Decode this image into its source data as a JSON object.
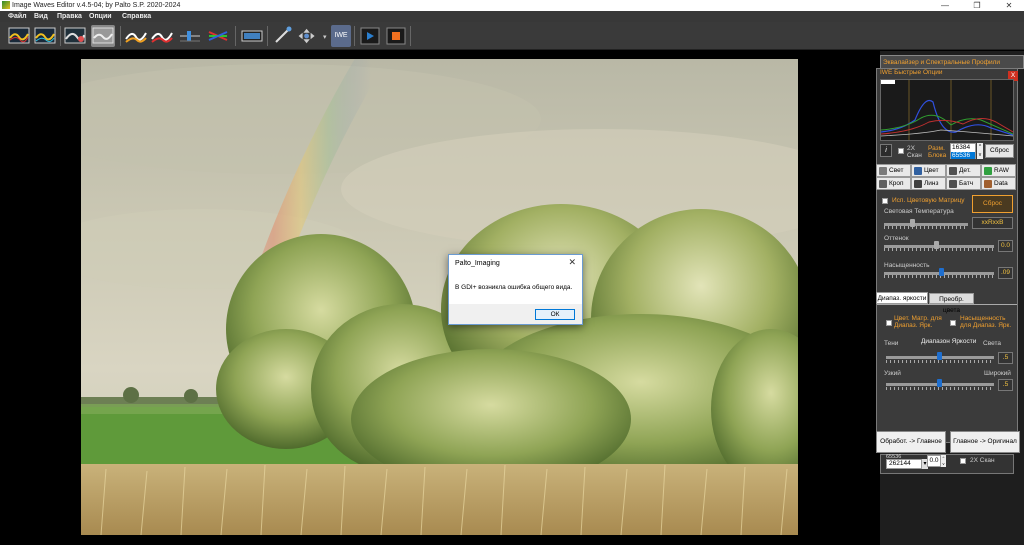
{
  "window": {
    "title": "Image Waves Editor  v.4.5-04; by Palto S.P.  2020-2024",
    "minimize": "—",
    "maximize": "❐",
    "close": "✕"
  },
  "menu": [
    "Файл",
    "Вид",
    "Правка",
    "Опции",
    "Справка"
  ],
  "toolbar": {
    "iwe_label": "IWE",
    "dropdown_arrow": "▾"
  },
  "panel": {
    "eq_title": "Эквалайзер и Спектральные Профили",
    "quick_title": "IWE Быстрые Опции",
    "close_x": "X",
    "info_btn": "i",
    "scan2x": "2X Скан",
    "block_size_label": "Разм. Блока",
    "block_size_values": [
      "16384",
      "65536"
    ],
    "reset_btn": "Сброс",
    "tabs": [
      {
        "label": "Свет",
        "icon": "light-icon"
      },
      {
        "label": "Цвет",
        "icon": "color-icon"
      },
      {
        "label": "Дет.",
        "icon": "detail-icon"
      },
      {
        "label": "RAW",
        "icon": "raw-icon"
      },
      {
        "label": "Кроп",
        "icon": "crop-icon"
      },
      {
        "label": "Линз",
        "icon": "lens-icon"
      },
      {
        "label": "Батч",
        "icon": "batch-icon"
      },
      {
        "label": "Data",
        "icon": "data-icon"
      }
    ],
    "color_matrix": "Исп. Цветовую Матрицу",
    "color_temp": "Световая Температура",
    "reset2": "Сброс",
    "rgb_value": "xxRxxB",
    "tint": "Оттенок",
    "tint_value": "0.0",
    "saturation": "Насыщенность",
    "saturation_value": ".09",
    "subtabs": [
      "Диапаз. яркости",
      "Преобр. цвета"
    ],
    "cb_matrix_range": "Цвет. Матр. для Диапаз. Ярк.",
    "cb_sat_range": "Насыщенность для Диапаз. Ярк.",
    "shadows": "Тени",
    "range_title": "Диапазон Яркости",
    "lights": "Света",
    "range_value": ".5",
    "narrow": "Узкий",
    "wide": "Широкий",
    "width_value": ".5",
    "btn_proc_main": "Обработ. -> Главное",
    "btn_main_orig": "Главное -> Оригинал",
    "bottom_small": "65536",
    "bottom_value": "262144",
    "bottom_num": "0.0",
    "bottom_scan": "2X Скан"
  },
  "dialog": {
    "title": "Palto_Imaging",
    "close": "✕",
    "message": "В GDI+ возникла ошибка общего вида.",
    "ok": "ОК"
  },
  "colors": {
    "accent_orange": "#f0a030",
    "selected_blue": "#0078d7",
    "panel_bg": "#3b3b3b",
    "toolbar_bg": "#3a3a3a"
  }
}
